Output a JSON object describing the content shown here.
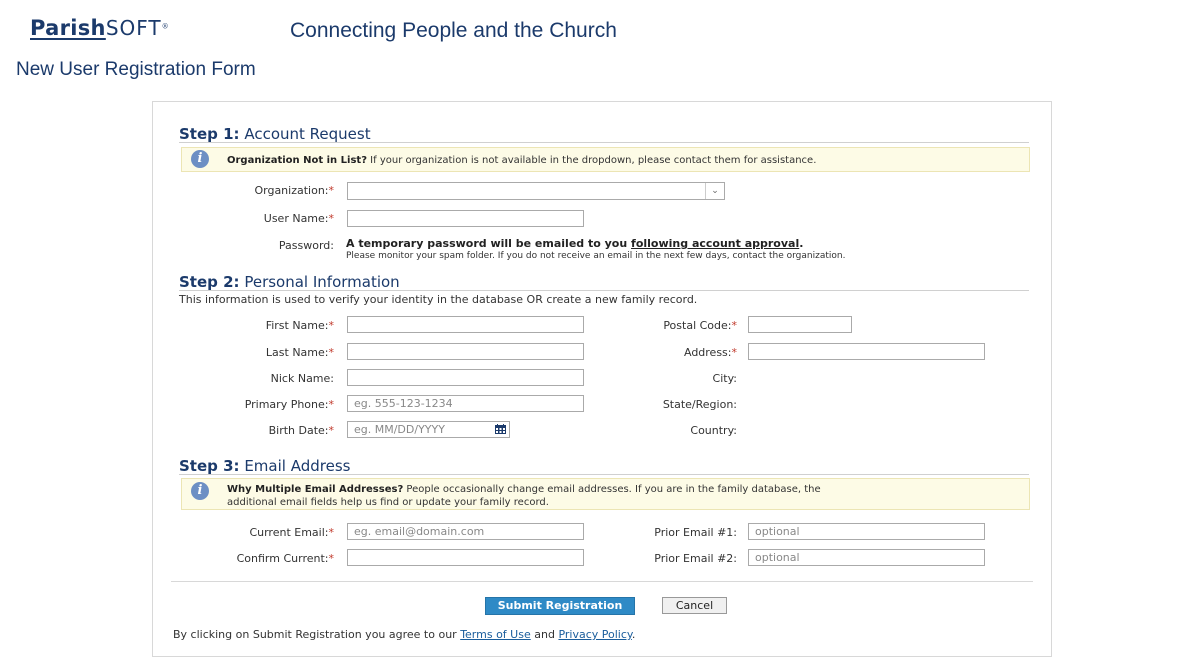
{
  "header": {
    "logo_parish": "Parish",
    "logo_soft": "SOFT",
    "logo_reg": "®",
    "tagline": "Connecting People and the Church"
  },
  "page_title": "New User Registration Form",
  "required_mark": "*",
  "step1": {
    "step_label": "Step 1:",
    "title": "Account Request",
    "info_bold": "Organization Not in List?",
    "info_text": " If your organization is not available in the dropdown, please contact them for assistance.",
    "organization_label": "Organization:",
    "organization_value": "",
    "username_label": "User Name:",
    "username_value": "",
    "password_label": "Password:",
    "password_main": "A temporary password will be emailed to you ",
    "password_link": "following account approval",
    "password_end": ".",
    "password_note": "Please monitor your spam folder. If you do not receive an email in the next few days, contact the organization."
  },
  "step2": {
    "step_label": "Step 2:",
    "title": "Personal Information",
    "description": "This information is used to verify your identity in the database OR create a new family record.",
    "first_name_label": "First Name:",
    "last_name_label": "Last Name:",
    "nick_name_label": "Nick Name:",
    "primary_phone_label": "Primary Phone:",
    "primary_phone_placeholder": "eg. 555-123-1234",
    "birth_date_label": "Birth Date:",
    "birth_date_placeholder": "eg. MM/DD/YYYY",
    "postal_code_label": "Postal Code:",
    "address_label": "Address:",
    "city_label": "City:",
    "state_label": "State/Region:",
    "country_label": "Country:"
  },
  "step3": {
    "step_label": "Step 3:",
    "title": "Email Address",
    "info_bold": "Why Multiple Email Addresses?",
    "info_text_line1": " People occasionally change email addresses. If you are in the family database, the",
    "info_text_line2": "additional email fields help us find or update your family record.",
    "current_email_label": "Current Email:",
    "current_email_placeholder": "eg. email@domain.com",
    "confirm_current_label": "Confirm Current:",
    "prior1_label": "Prior Email #1:",
    "prior1_placeholder": "optional",
    "prior2_label": "Prior Email #2:",
    "prior2_placeholder": "optional"
  },
  "actions": {
    "submit_label": "Submit Registration",
    "cancel_label": "Cancel"
  },
  "footer": {
    "text_before": "By clicking on Submit Registration you agree to our ",
    "terms_link": "Terms of Use",
    "and": " and ",
    "privacy_link": "Privacy Policy",
    "end": "."
  },
  "icons": {
    "info": "info-icon",
    "dropdown": "chevron-down-icon",
    "calendar": "calendar-icon"
  },
  "colors": {
    "brand": "#1b3a6b",
    "required": "#c0392b",
    "submit_button": "#2e8ac6",
    "info_box": "#fdfbe6",
    "link": "#1a5d9c"
  }
}
